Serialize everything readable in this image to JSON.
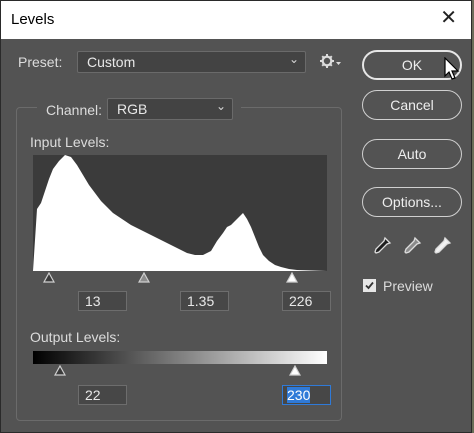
{
  "window": {
    "title": "Levels",
    "close_icon": "close-icon"
  },
  "preset": {
    "label": "Preset:",
    "value": "Custom",
    "settings_icon": "gear-icon"
  },
  "channel": {
    "label": "Channel:",
    "value": "RGB"
  },
  "input_levels": {
    "label": "Input Levels:",
    "black": "13",
    "gamma": "1.35",
    "white": "226"
  },
  "output_levels": {
    "label": "Output Levels:",
    "black": "22",
    "white": "230"
  },
  "buttons": {
    "ok": "OK",
    "cancel": "Cancel",
    "auto": "Auto",
    "options": "Options..."
  },
  "preview": {
    "label": "Preview",
    "checked": true
  },
  "colors": {
    "dialog_bg": "#535353",
    "histogram_bg": "#3b3b3b",
    "selection": "#2f7ad8"
  }
}
